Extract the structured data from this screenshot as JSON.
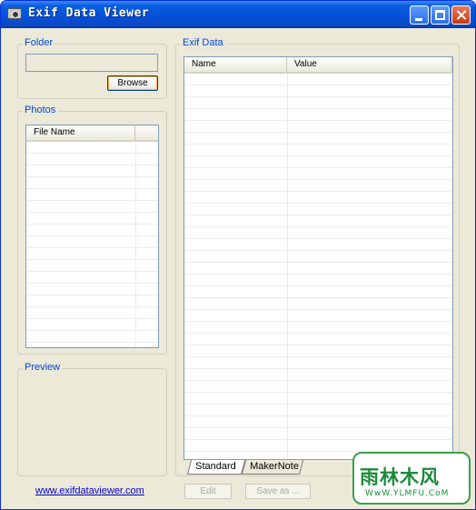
{
  "window": {
    "title": "Exif Data Viewer"
  },
  "folder": {
    "label": "Folder",
    "path_value": "",
    "browse_label": "Browse"
  },
  "photos": {
    "label": "Photos",
    "column_file_name": "File Name"
  },
  "preview": {
    "label": "Preview"
  },
  "exif": {
    "label": "Exif Data",
    "column_name": "Name",
    "column_value": "Value",
    "tabs": [
      "Standard",
      "MakerNote"
    ]
  },
  "footer": {
    "website_link": "www.exifdataviewer.com",
    "edit_label": "Edit",
    "save_label": "Save as ..."
  },
  "watermark": {
    "main": "雨林木风",
    "sub": "WwW.YLMFU.CoM"
  },
  "colors": {
    "titlebar": "#0451d8",
    "group_label": "#0046d5",
    "watermark": "#1c8a3a"
  }
}
